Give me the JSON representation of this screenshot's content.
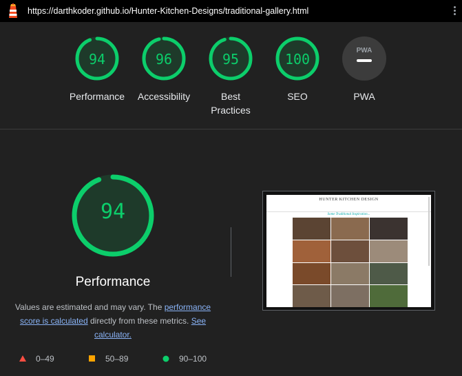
{
  "url": "https://darthkoder.github.io/Hunter-Kitchen-Designs/traditional-gallery.html",
  "colors": {
    "pass": "#0cce6b",
    "average": "#ffa400",
    "fail": "#ff4e42",
    "pwa": "#9aa0a6"
  },
  "categories": [
    {
      "score": "94",
      "label": "Performance",
      "value": 94
    },
    {
      "score": "96",
      "label": "Accessibility",
      "value": 96
    },
    {
      "score": "95",
      "label": "Best Practices",
      "value": 95
    },
    {
      "score": "100",
      "label": "SEO",
      "value": 100
    },
    {
      "score": "",
      "label": "PWA",
      "badge_text": "PWA",
      "icon": "pwa-dash-icon"
    }
  ],
  "main": {
    "score": "94",
    "value": 94,
    "title": "Performance",
    "desc_part1": "Values are estimated and may vary. The ",
    "desc_link1": "performance score is calculated",
    "desc_part2": " directly from these metrics. ",
    "desc_link2": "See calculator."
  },
  "legend": [
    {
      "range": "0–49",
      "icon": "triangle-icon"
    },
    {
      "range": "50–89",
      "icon": "square-icon"
    },
    {
      "range": "90–100",
      "icon": "circle-icon"
    }
  ],
  "screenshot": {
    "site_title": "HUNTER KITCHEN DESIGN",
    "tagline": "Some Traditional Inspiration..."
  }
}
